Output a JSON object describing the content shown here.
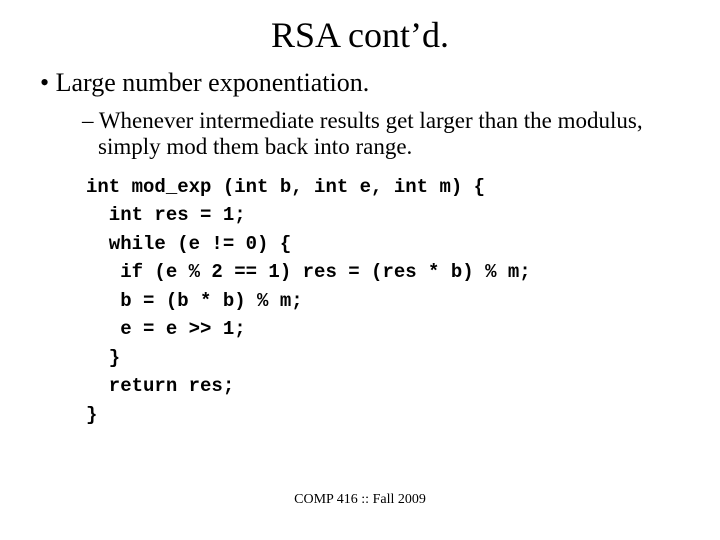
{
  "title": "RSA cont’d.",
  "bullet_l1": "Large number exponentiation.",
  "bullet_l2": "Whenever intermediate results get larger than the modulus, simply mod them back into range.",
  "code": "int mod_exp (int b, int e, int m) {\n  int res = 1;\n  while (e != 0) {\n   if (e % 2 == 1) res = (res * b) % m;\n   b = (b * b) % m;\n   e = e >> 1;\n  }\n  return res;\n}",
  "footer": "COMP 416 :: Fall 2009"
}
